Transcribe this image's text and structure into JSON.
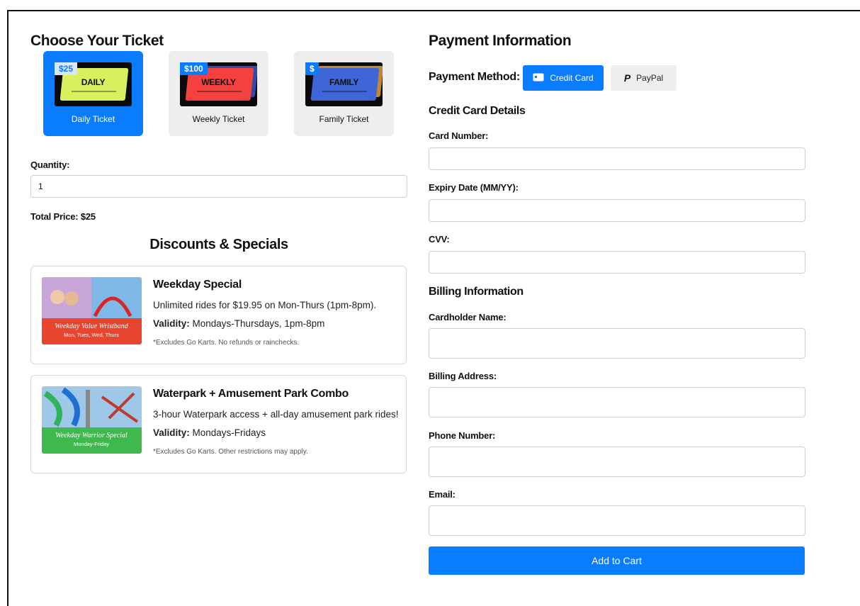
{
  "ticket_section": {
    "title": "Choose Your Ticket",
    "tickets": [
      {
        "price": "$25",
        "art_text": "DAILY",
        "label": "Daily Ticket",
        "color": "#d9ef5e",
        "selected": true
      },
      {
        "price": "$100",
        "art_text": "WEEKLY",
        "label": "Weekly Ticket",
        "color": "#f2413f",
        "selected": false
      },
      {
        "price": "$",
        "art_text": "FAMILY",
        "label": "Family Ticket",
        "color": "#3f66d6",
        "selected": false
      }
    ]
  },
  "quantity": {
    "label": "Quantity:",
    "value": "1"
  },
  "total_price": "Total Price: $25",
  "discounts": {
    "title": "Discounts & Specials",
    "deals": [
      {
        "title": "Weekday Special",
        "description": "Unlimited rides for $19.95 on Mon-Thurs (1pm-8pm).",
        "validity_label": "Validity:",
        "validity": "Mondays-Thursdays, 1pm-8pm",
        "note": "*Excludes Go Karts. No refunds or rainchecks.",
        "image_text": "Weekday Value Wristband",
        "image_subtext": "Mon, Tues, Wed, Thurs"
      },
      {
        "title": "Waterpark + Amusement Park Combo",
        "description": "3-hour Waterpark access + all-day amusement park rides!",
        "validity_label": "Validity:",
        "validity": "Mondays-Fridays",
        "note": "*Excludes Go Karts. Other restrictions may apply.",
        "image_text": "Weekday Warrior Special",
        "image_subtext": "Monday-Friday"
      }
    ]
  },
  "payment": {
    "title": "Payment Information",
    "method_label": "Payment Method:",
    "methods": [
      {
        "label": "Credit Card",
        "active": true
      },
      {
        "label": "PayPal",
        "active": false
      }
    ],
    "card_details_title": "Credit Card Details",
    "card_number_label": "Card Number:",
    "card_number_value": "",
    "expiry_label": "Expiry Date (MM/YY):",
    "expiry_value": "",
    "cvv_label": "CVV:",
    "cvv_value": "",
    "billing_title": "Billing Information",
    "cardholder_label": "Cardholder Name:",
    "cardholder_value": "",
    "address_label": "Billing Address:",
    "address_value": "",
    "phone_label": "Phone Number:",
    "phone_value": "",
    "email_label": "Email:",
    "email_value": "",
    "submit_label": "Add to Cart"
  },
  "colors": {
    "accent": "#0a7cff",
    "card_bg": "#eeeeee"
  }
}
